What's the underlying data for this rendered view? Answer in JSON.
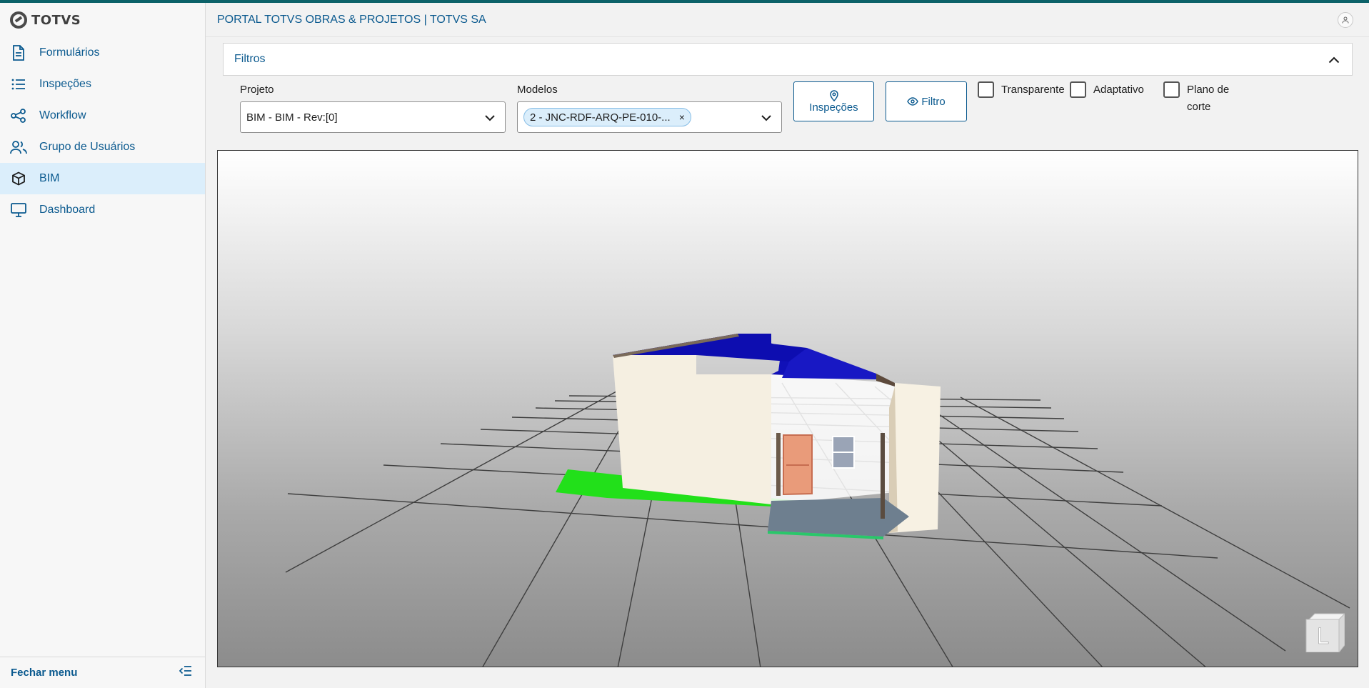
{
  "brand": {
    "name": "TOTVS"
  },
  "header": {
    "title": "PORTAL TOTVS OBRAS & PROJETOS | TOTVS SA"
  },
  "sidebar": {
    "items": [
      {
        "label": "Formulários",
        "icon": "document-icon"
      },
      {
        "label": "Inspeções",
        "icon": "list-icon"
      },
      {
        "label": "Workflow",
        "icon": "share-icon"
      },
      {
        "label": "Grupo de Usuários",
        "icon": "users-icon"
      },
      {
        "label": "BIM",
        "icon": "cube-icon",
        "active": true
      },
      {
        "label": "Dashboard",
        "icon": "monitor-icon"
      }
    ],
    "footer": {
      "label": "Fechar menu"
    }
  },
  "filters": {
    "title": "Filtros",
    "projeto": {
      "label": "Projeto",
      "value": "BIM - BIM - Rev:[0]"
    },
    "modelos": {
      "label": "Modelos",
      "chip": "2 - JNC-RDF-ARQ-PE-010-...",
      "chip_remove": "×"
    },
    "buttons": {
      "inspecoes": "Inspeções",
      "filtro": "Filtro"
    },
    "checkboxes": {
      "transparente": {
        "label": "Transparente",
        "checked": false
      },
      "adaptativo": {
        "label": "Adaptativo",
        "checked": false
      },
      "plano_line1": "Plano de",
      "plano_line2": "corte",
      "plano_checked": false
    }
  },
  "viewer": {
    "navcube_face": "L"
  },
  "colors": {
    "brand_teal": "#0c6269",
    "link_blue": "#0b5a8f",
    "active_bg": "#dbeefb",
    "roof": "#1010b8",
    "ground": "#22e01a",
    "wall": "#f7f2e6",
    "door": "#e99b7a"
  }
}
